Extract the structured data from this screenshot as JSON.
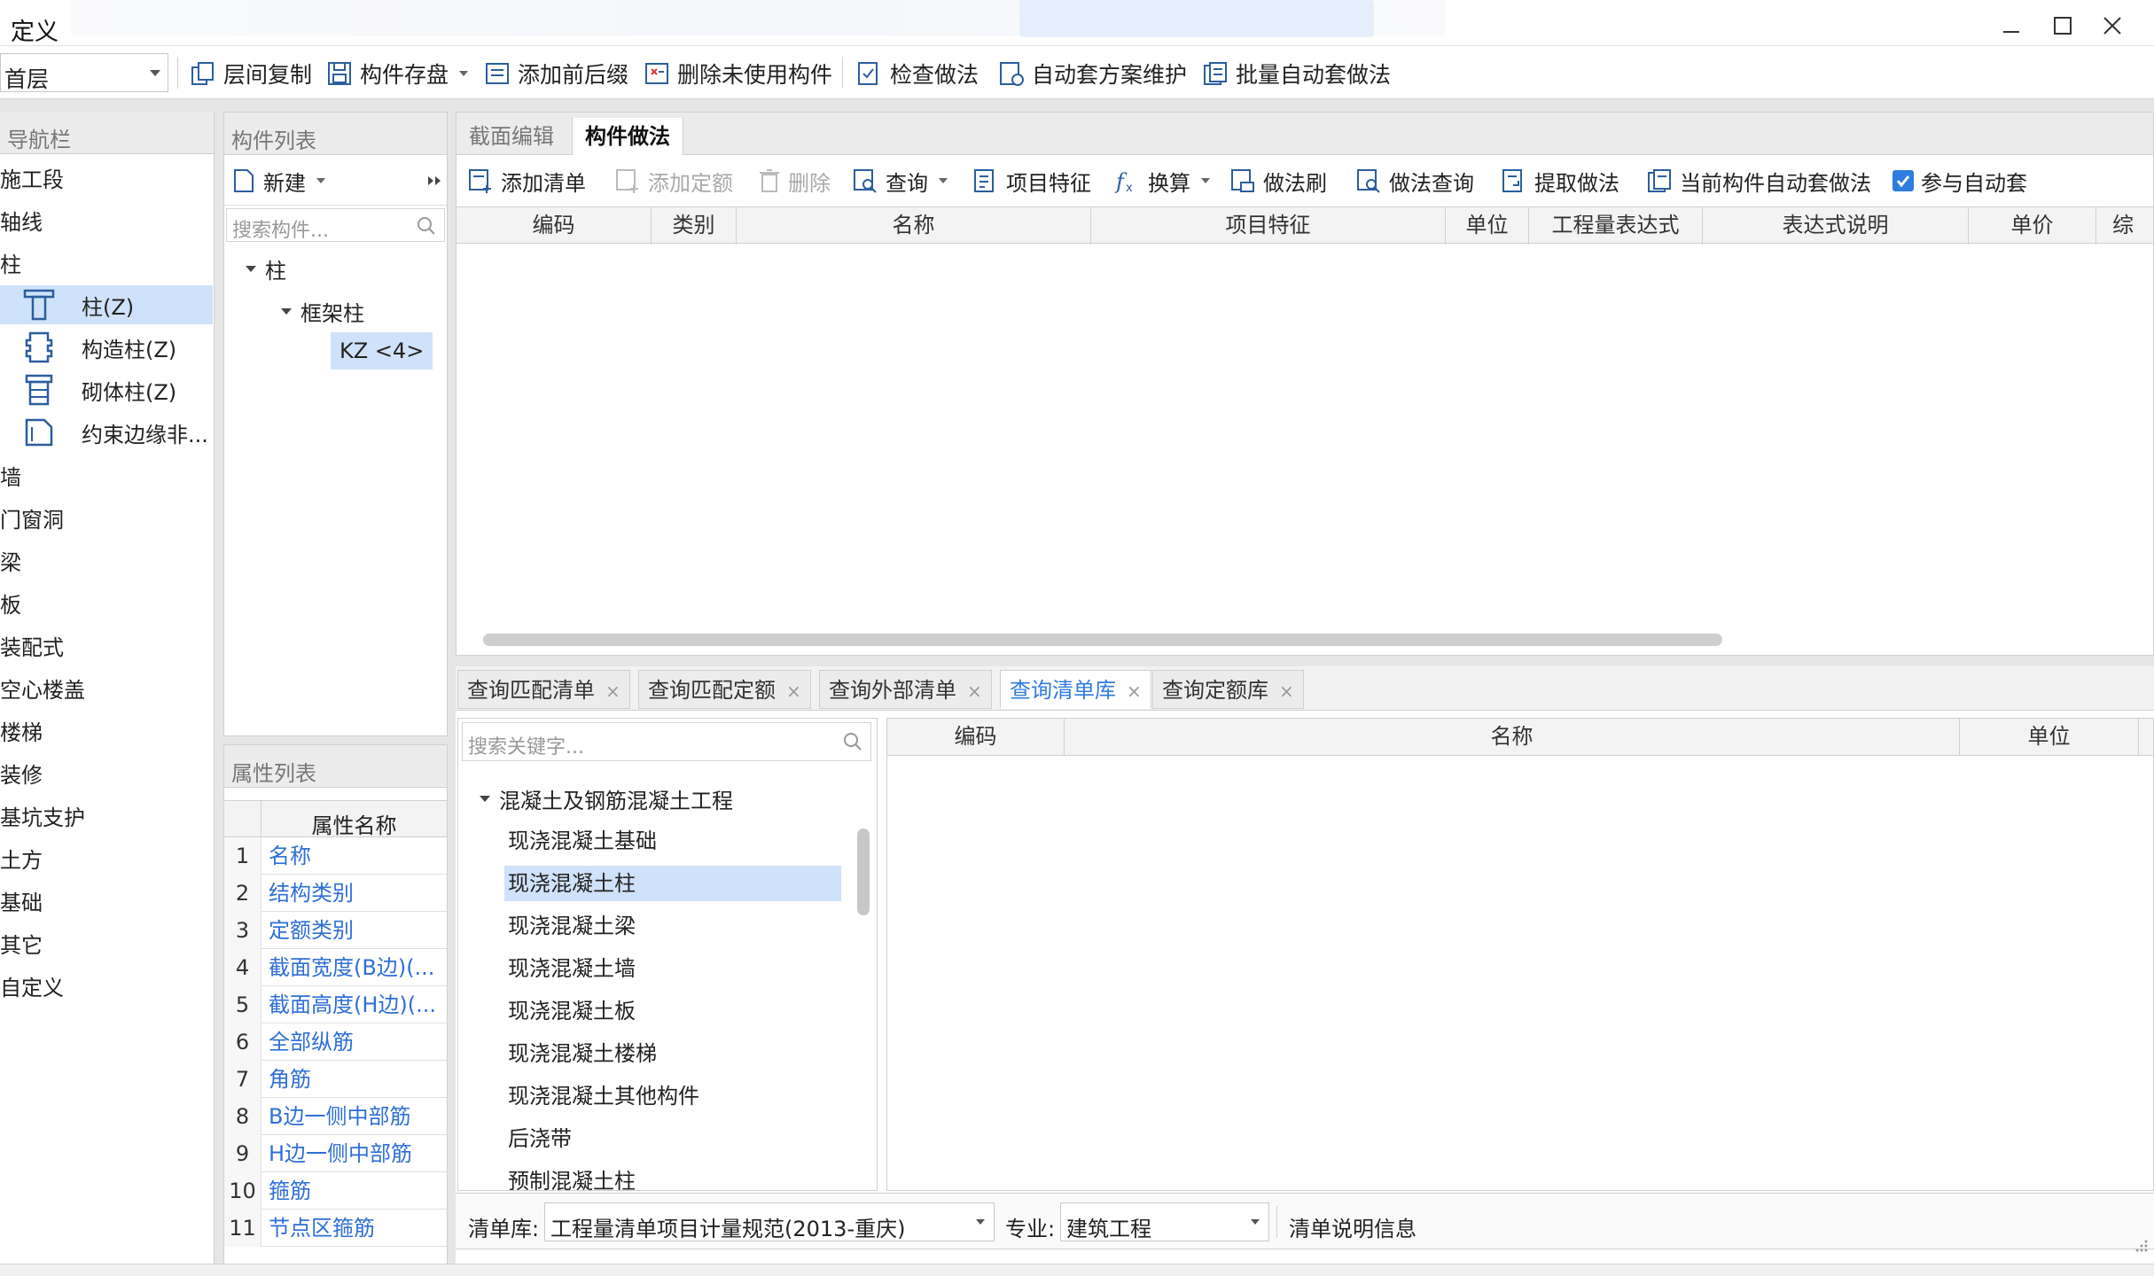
{
  "window": {
    "title": "定义"
  },
  "toolbar": {
    "floor_value": "首层",
    "items": [
      {
        "label": "层间复制",
        "icon": "copy-floor-icon"
      },
      {
        "label": "构件存盘",
        "icon": "save-component-icon"
      },
      {
        "label": "添加前后缀",
        "icon": "add-affix-icon"
      },
      {
        "label": "删除未使用构件",
        "icon": "delete-unused-icon"
      },
      {
        "label": "检查做法",
        "icon": "check-method-icon"
      },
      {
        "label": "自动套方案维护",
        "icon": "auto-scheme-icon"
      },
      {
        "label": "批量自动套做法",
        "icon": "batch-auto-icon"
      }
    ]
  },
  "nav": {
    "header": "导航栏",
    "items": [
      {
        "label": "施工段",
        "level": 0
      },
      {
        "label": "轴线",
        "level": 0
      },
      {
        "label": "柱",
        "level": 0
      },
      {
        "label": "柱(Z)",
        "level": 1,
        "icon": "column-icon",
        "selected": true
      },
      {
        "label": "构造柱(Z)",
        "level": 1,
        "icon": "constructional-column-icon"
      },
      {
        "label": "砌体柱(Z)",
        "level": 1,
        "icon": "masonry-column-icon"
      },
      {
        "label": "约束边缘非...",
        "level": 1,
        "icon": "edge-member-icon"
      },
      {
        "label": "墙",
        "level": 0
      },
      {
        "label": "门窗洞",
        "level": 0
      },
      {
        "label": "梁",
        "level": 0
      },
      {
        "label": "板",
        "level": 0
      },
      {
        "label": "装配式",
        "level": 0
      },
      {
        "label": "空心楼盖",
        "level": 0
      },
      {
        "label": "楼梯",
        "level": 0
      },
      {
        "label": "装修",
        "level": 0
      },
      {
        "label": "基坑支护",
        "level": 0
      },
      {
        "label": "土方",
        "level": 0
      },
      {
        "label": "基础",
        "level": 0
      },
      {
        "label": "其它",
        "level": 0
      },
      {
        "label": "自定义",
        "level": 0
      }
    ]
  },
  "component_list": {
    "header": "构件列表",
    "new_label": "新建",
    "search_placeholder": "搜索构件...",
    "tree": [
      {
        "label": "柱",
        "level": 0
      },
      {
        "label": "框架柱",
        "level": 1
      },
      {
        "label": "KZ <4>",
        "level": 2,
        "selected": true
      }
    ]
  },
  "properties": {
    "header": "属性列表",
    "col_name": "属性名称",
    "rows": [
      {
        "num": "1",
        "name": "名称"
      },
      {
        "num": "2",
        "name": "结构类别"
      },
      {
        "num": "3",
        "name": "定额类别"
      },
      {
        "num": "4",
        "name": "截面宽度(B边)(..."
      },
      {
        "num": "5",
        "name": "截面高度(H边)(..."
      },
      {
        "num": "6",
        "name": "全部纵筋"
      },
      {
        "num": "7",
        "name": "角筋"
      },
      {
        "num": "8",
        "name": "B边一侧中部筋"
      },
      {
        "num": "9",
        "name": "H边一侧中部筋"
      },
      {
        "num": "10",
        "name": "箍筋"
      },
      {
        "num": "11",
        "name": "节点区箍筋"
      }
    ]
  },
  "main": {
    "tabs": [
      "截面编辑",
      "构件做法"
    ],
    "active_tab": 1,
    "actions": [
      {
        "label": "添加清单",
        "icon": "add-list-icon",
        "enabled": true
      },
      {
        "label": "添加定额",
        "icon": "add-quota-icon",
        "enabled": false
      },
      {
        "label": "删除",
        "icon": "trash-icon",
        "enabled": false
      },
      {
        "label": "查询",
        "icon": "query-icon",
        "enabled": true,
        "dropdown": true
      },
      {
        "label": "项目特征",
        "icon": "feature-icon",
        "enabled": true
      },
      {
        "label": "换算",
        "icon": "fx-icon",
        "enabled": true,
        "dropdown": true
      },
      {
        "label": "做法刷",
        "icon": "brush-icon",
        "enabled": true
      },
      {
        "label": "做法查询",
        "icon": "method-query-icon",
        "enabled": true
      },
      {
        "label": "提取做法",
        "icon": "extract-icon",
        "enabled": true
      },
      {
        "label": "当前构件自动套做法",
        "icon": "auto-apply-icon",
        "enabled": true
      }
    ],
    "auto_checkbox_label": "参与自动套",
    "columns": [
      "编码",
      "类别",
      "名称",
      "项目特征",
      "单位",
      "工程量表达式",
      "表达式说明",
      "单价",
      "综"
    ]
  },
  "bottom": {
    "tabs": [
      "查询匹配清单",
      "查询匹配定额",
      "查询外部清单",
      "查询清单库",
      "查询定额库"
    ],
    "active_tab": 3,
    "search_placeholder": "搜索关键字...",
    "tree_root": "混凝土及钢筋混凝土工程",
    "tree_children": [
      "现浇混凝土基础",
      "现浇混凝土柱",
      "现浇混凝土梁",
      "现浇混凝土墙",
      "现浇混凝土板",
      "现浇混凝土楼梯",
      "现浇混凝土其他构件",
      "后浇带",
      "预制混凝土柱"
    ],
    "selected_child": 1,
    "columns": [
      "编码",
      "名称",
      "单位"
    ],
    "footer": {
      "library_label": "清单库:",
      "library_value": "工程量清单项目计量规范(2013-重庆)",
      "discipline_label": "专业:",
      "discipline_value": "建筑工程",
      "info_label": "清单说明信息"
    }
  },
  "colors": {
    "accent": "#2f7be0",
    "selection": "#cfe2fb",
    "link": "#2f6fd6"
  }
}
